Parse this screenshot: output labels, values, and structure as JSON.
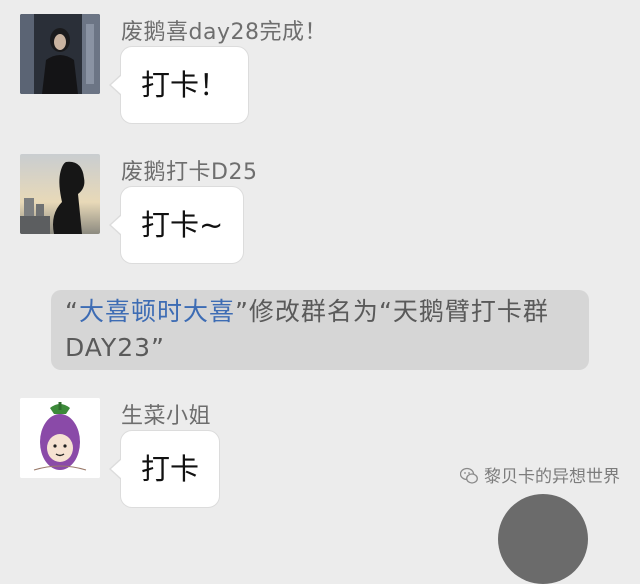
{
  "messages": [
    {
      "sender": "废鹅喜day28完成！",
      "text": "打卡！",
      "avatar": "woman-dark-photo-avatar"
    },
    {
      "sender": "废鹅打卡D25",
      "text": "打卡~",
      "avatar": "silhouette-sunset-avatar"
    },
    {
      "sender": "生菜小姐",
      "text": "打卡",
      "avatar": "eggplant-cartoon-avatar"
    }
  ],
  "system_notice": {
    "quote_open": "“",
    "member_name": "大喜顿时大喜",
    "quote_close": "”",
    "action": "修改群名为",
    "new_name": "“天鹅臂打卡群DAY23”"
  },
  "watermark": {
    "text": "黎贝卡的异想世界",
    "icon": "wechat-logo-icon"
  },
  "colors": {
    "background": "#ececec",
    "bubble": "#ffffff",
    "system_bg": "#d6d6d6",
    "link": "#3d6cb4"
  }
}
